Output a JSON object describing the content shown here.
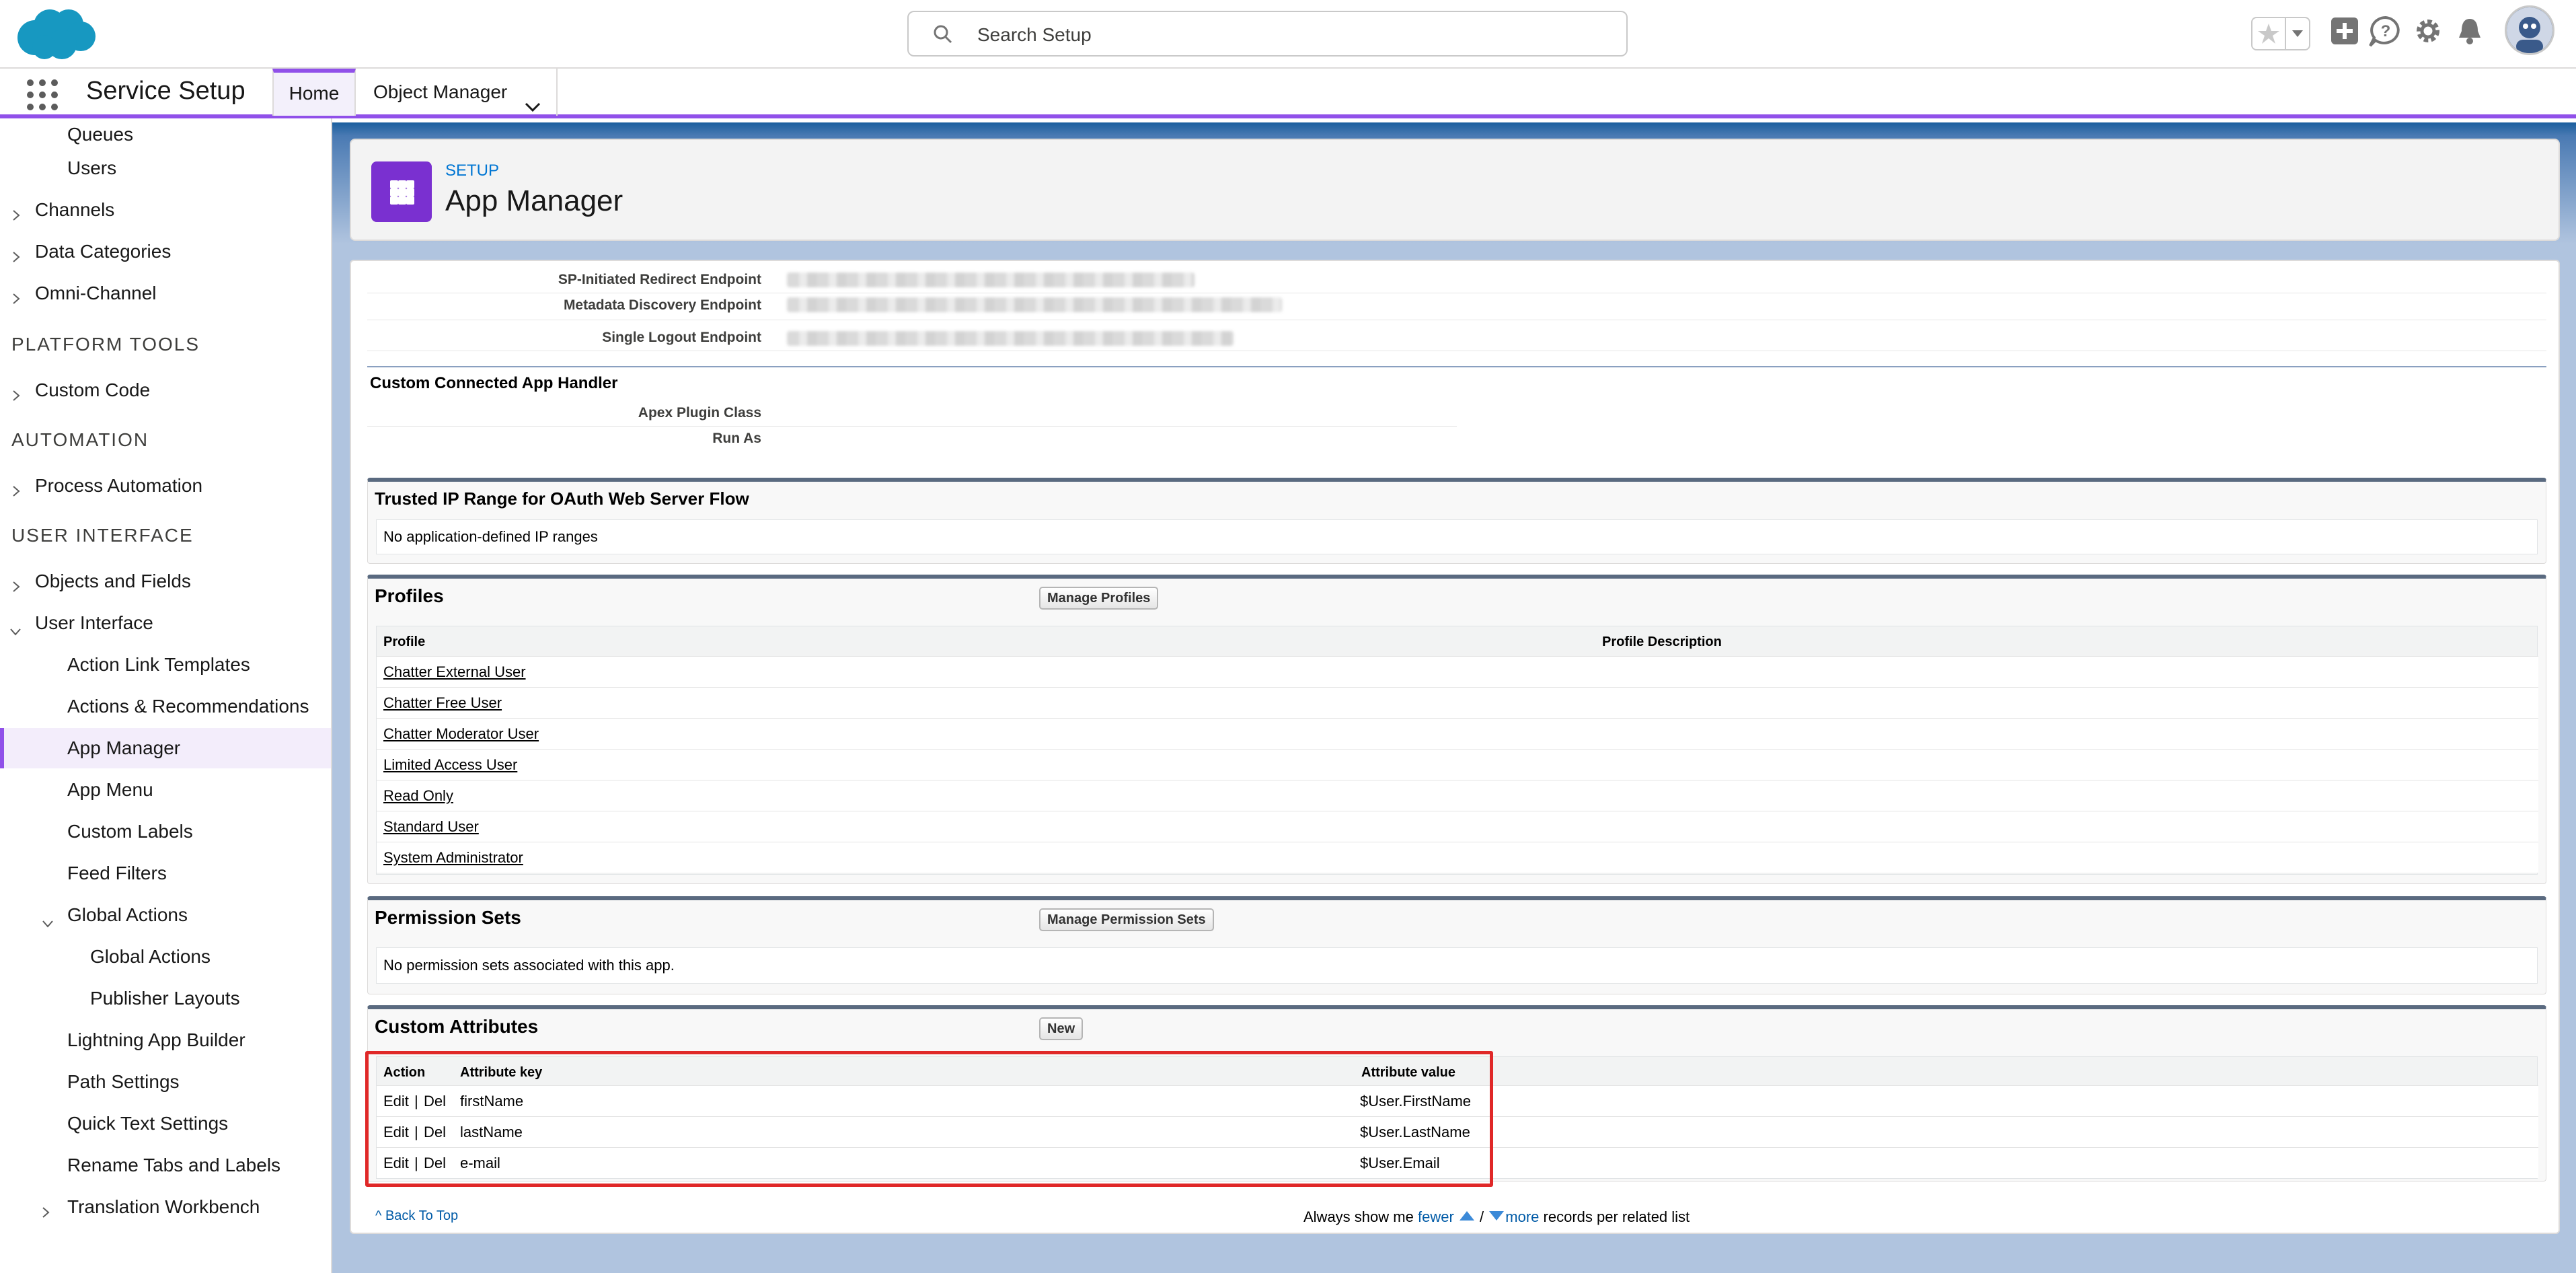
{
  "header": {
    "search_placeholder": "Search Setup"
  },
  "context_bar": {
    "app_name": "Service Setup",
    "tabs": [
      {
        "label": "Home"
      },
      {
        "label": "Object Manager"
      }
    ]
  },
  "sidebar": {
    "items": [
      {
        "label": "Queues"
      },
      {
        "label": "Users"
      },
      {
        "label": "Channels"
      },
      {
        "label": "Data Categories"
      },
      {
        "label": "Omni-Channel"
      },
      {
        "label": "Custom Code"
      },
      {
        "label": "Process Automation"
      },
      {
        "label": "Objects and Fields"
      },
      {
        "label": "User Interface"
      },
      {
        "label": "Action Link Templates"
      },
      {
        "label": "Actions & Recommendations"
      },
      {
        "label": "App Manager"
      },
      {
        "label": "App Menu"
      },
      {
        "label": "Custom Labels"
      },
      {
        "label": "Feed Filters"
      },
      {
        "label": "Global Actions"
      },
      {
        "label": "Global Actions"
      },
      {
        "label": "Publisher Layouts"
      },
      {
        "label": "Lightning App Builder"
      },
      {
        "label": "Path Settings"
      },
      {
        "label": "Quick Text Settings"
      },
      {
        "label": "Rename Tabs and Labels"
      },
      {
        "label": "Translation Workbench"
      }
    ],
    "sections": {
      "platform_tools": "PLATFORM TOOLS",
      "automation": "AUTOMATION",
      "user_interface": "USER INTERFACE"
    }
  },
  "page_header": {
    "breadcrumb": "SETUP",
    "title": "App Manager"
  },
  "saml": {
    "rows": [
      {
        "label": "SP-Initiated Redirect Endpoint"
      },
      {
        "label": "Metadata Discovery Endpoint"
      },
      {
        "label": "Single Logout Endpoint"
      }
    ]
  },
  "handler": {
    "title": "Custom Connected App Handler",
    "rows": [
      {
        "label": "Apex Plugin Class"
      },
      {
        "label": "Run As"
      }
    ]
  },
  "ip_range": {
    "title": "Trusted IP Range for OAuth Web Server Flow",
    "message": "No application-defined IP ranges"
  },
  "profiles": {
    "title": "Profiles",
    "button": "Manage Profiles",
    "columns": [
      "Profile",
      "Profile Description"
    ],
    "rows": [
      {
        "name": "Chatter External User"
      },
      {
        "name": "Chatter Free User"
      },
      {
        "name": "Chatter Moderator User"
      },
      {
        "name": "Limited Access User"
      },
      {
        "name": "Read Only"
      },
      {
        "name": "Standard User"
      },
      {
        "name": "System Administrator"
      }
    ]
  },
  "permission_sets": {
    "title": "Permission Sets",
    "button": "Manage Permission Sets",
    "message": "No permission sets associated with this app."
  },
  "custom_attributes": {
    "title": "Custom Attributes",
    "button": "New",
    "columns": [
      "Action",
      "Attribute key",
      "Attribute value"
    ],
    "edit_label": "Edit",
    "sep": "|",
    "del_label": "Del",
    "rows": [
      {
        "key": "firstName",
        "value": "$User.FirstName"
      },
      {
        "key": "lastName",
        "value": "$User.LastName"
      },
      {
        "key": "e-mail",
        "value": "$User.Email"
      }
    ]
  },
  "footer": {
    "back_to_top": "Back To Top",
    "pager_prefix": "Always show me",
    "fewer": "fewer",
    "slash": "/",
    "more": "more",
    "pager_suffix": "records per related list"
  },
  "colors": {
    "accent": "#9050e9",
    "link": "#015ba7",
    "highlight": "#e02828",
    "brand_cloud": "#1798c1"
  }
}
